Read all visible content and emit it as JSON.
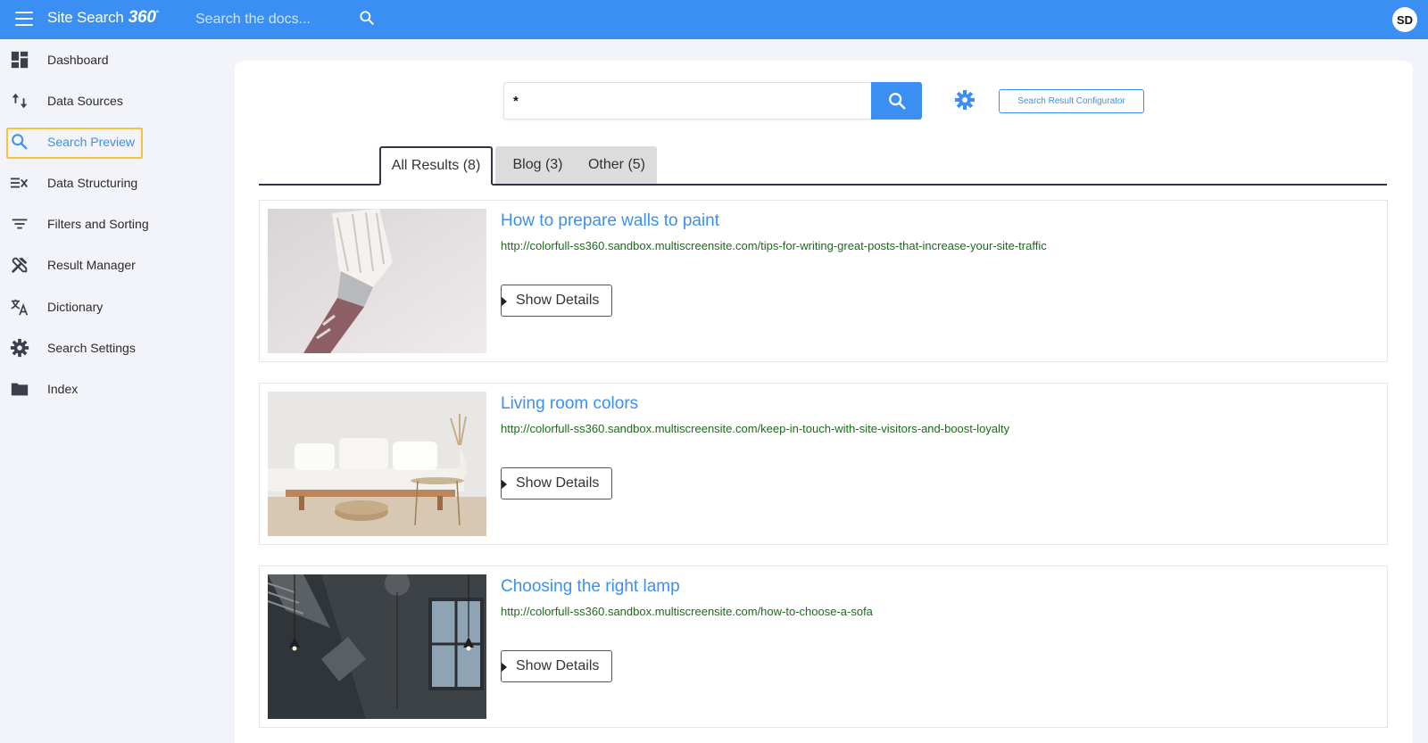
{
  "header": {
    "brand_text": "Site Search",
    "brand_logo": "360",
    "search_placeholder": "Search the docs...",
    "avatar_initials": "SD",
    "bar_color": "#3b8ff3"
  },
  "sidebar": {
    "active_index": 2,
    "items": [
      {
        "label": "Dashboard",
        "icon": "dashboard-icon"
      },
      {
        "label": "Data Sources",
        "icon": "swap-vertical-icon"
      },
      {
        "label": "Search Preview",
        "icon": "search-icon"
      },
      {
        "label": "Data Structuring",
        "icon": "data-structuring-icon"
      },
      {
        "label": "Filters and Sorting",
        "icon": "filter-icon"
      },
      {
        "label": "Result Manager",
        "icon": "tools-icon"
      },
      {
        "label": "Dictionary",
        "icon": "translate-icon"
      },
      {
        "label": "Search Settings",
        "icon": "gear-icon"
      },
      {
        "label": "Index",
        "icon": "folder-icon"
      }
    ]
  },
  "preview": {
    "query": "*",
    "configurator_label": "Search Result Configurator",
    "tabs": [
      {
        "label": "All Results (8)",
        "active": true
      },
      {
        "label": "Blog (3)",
        "active": false
      },
      {
        "label": "Other (5)",
        "active": false
      }
    ],
    "results": [
      {
        "title": "How to prepare walls to paint",
        "url": "http://colorfull-ss360.sandbox.multiscreensite.com/tips-for-writing-great-posts-that-increase-your-site-traffic",
        "details_label": "Show Details",
        "image": "paintbrush-photo"
      },
      {
        "title": "Living room colors",
        "url": "http://colorfull-ss360.sandbox.multiscreensite.com/keep-in-touch-with-site-visitors-and-boost-loyalty",
        "details_label": "Show Details",
        "image": "sofa-photo"
      },
      {
        "title": "Choosing the right lamp",
        "url": "http://colorfull-ss360.sandbox.multiscreensite.com/how-to-choose-a-sofa",
        "details_label": "Show Details",
        "image": "lamp-photo"
      }
    ]
  }
}
